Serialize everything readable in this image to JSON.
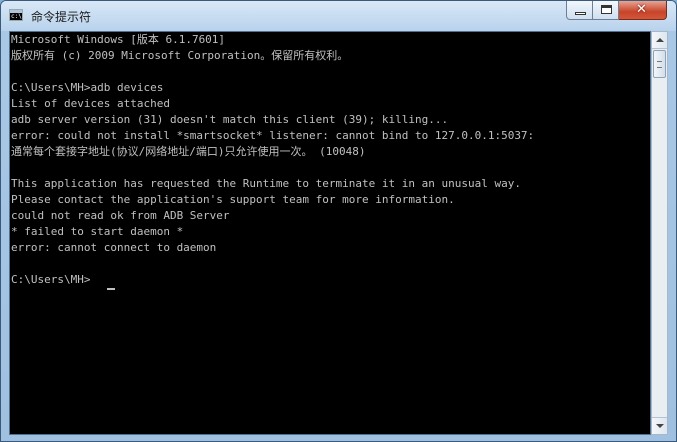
{
  "window": {
    "title": "命令提示符",
    "icon": "cmd-icon",
    "controls": {
      "minimize": "minimize-icon",
      "maximize": "maximize-icon",
      "close": "✕"
    }
  },
  "console": {
    "lines": [
      "Microsoft Windows [版本 6.1.7601]",
      "版权所有 (c) 2009 Microsoft Corporation。保留所有权利。",
      "",
      "C:\\Users\\MH>adb devices",
      "List of devices attached",
      "adb server version (31) doesn't match this client (39); killing...",
      "error: could not install *smartsocket* listener: cannot bind to 127.0.0.1:5037:",
      "通常每个套接字地址(协议/网络地址/端口)只允许使用一次。 (10048)",
      "",
      "This application has requested the Runtime to terminate it in an unusual way.",
      "Please contact the application's support team for more information.",
      "could not read ok from ADB Server",
      "* failed to start daemon *",
      "error: cannot connect to daemon",
      "",
      "C:\\Users\\MH>"
    ],
    "text_color": "#c0c0c0",
    "background": "#000000"
  }
}
